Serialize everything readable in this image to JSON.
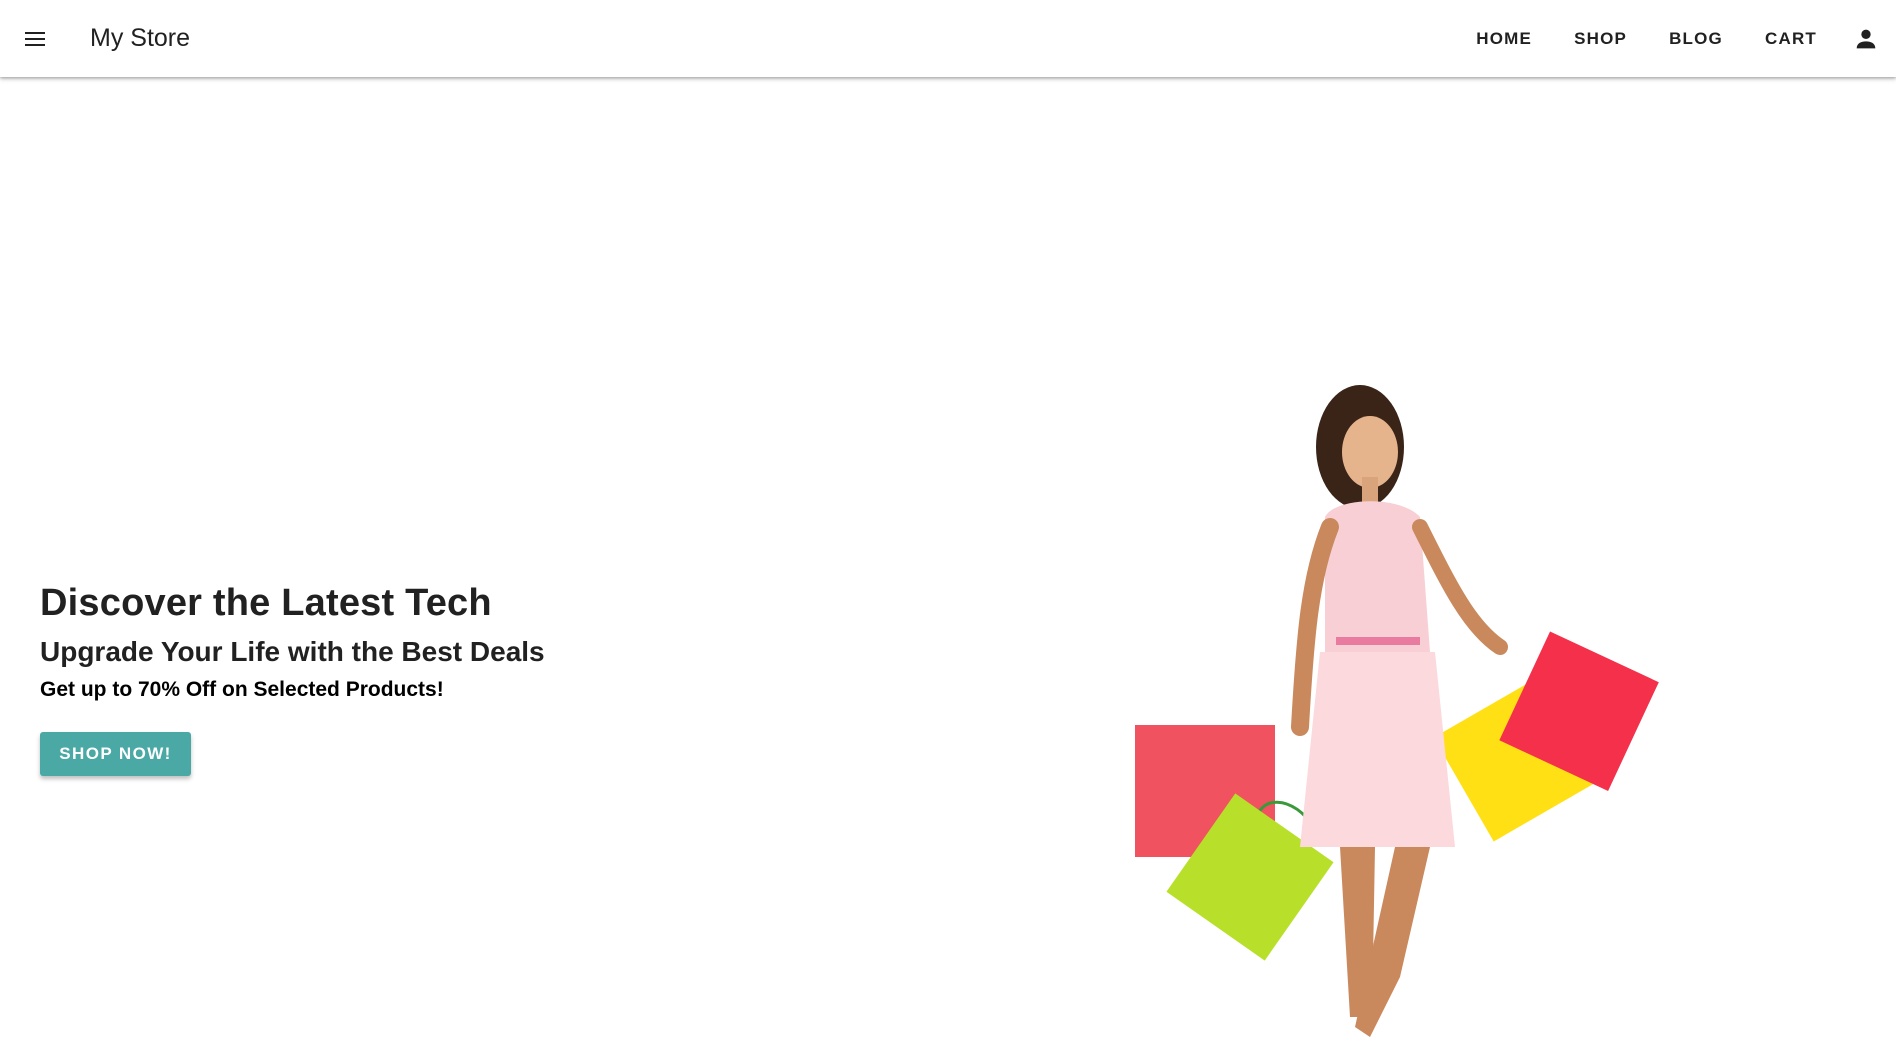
{
  "app_bar": {
    "title": "My Store",
    "menu_icon": "menu-icon",
    "nav": [
      "HOME",
      "SHOP",
      "BLOG",
      "CART"
    ],
    "account_icon": "account-icon"
  },
  "hero": {
    "heading": "Discover the Latest Tech",
    "subheading": "Upgrade Your Life with the Best Deals",
    "offer": "Get up to 70% Off on Selected Products!",
    "cta_label": "SHOP NOW!",
    "accent_color": "#4aa8a5",
    "image": "woman-with-shopping-bags"
  }
}
